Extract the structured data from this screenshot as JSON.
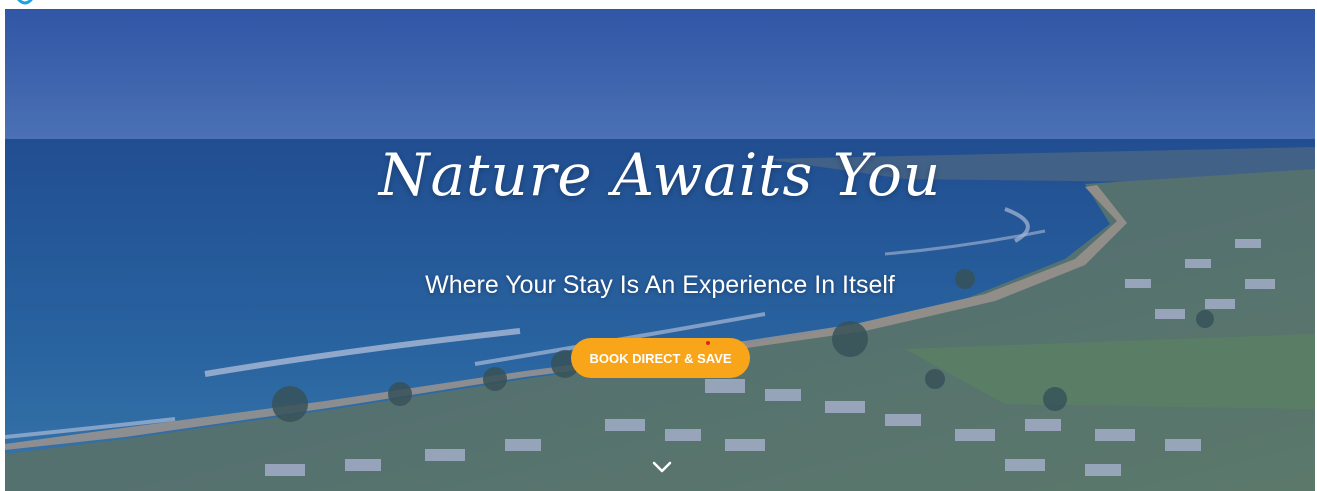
{
  "hero": {
    "headline": "Nature Awaits You",
    "subheadline": "Where Your Stay Is An Experience In Itself",
    "cta_label": "BOOK DIRECT & SAVE"
  },
  "colors": {
    "cta_background": "#f9a51a",
    "overlay": "#263e8c",
    "sky": "#3b67b3",
    "ocean": "#2a6fa8",
    "land": "#6b8a63"
  },
  "icons": {
    "logo": "logo-fragment-icon",
    "scroll": "chevron-down-icon"
  }
}
